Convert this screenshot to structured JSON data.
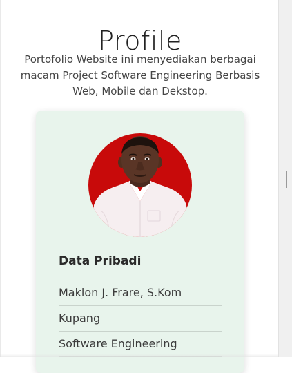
{
  "header": {
    "title": "Profile",
    "subtitle": "Portofolio Website ini menyediakan berbagai macam Project Software Engineering Berbasis Web, Mobile dan Dekstop."
  },
  "profile": {
    "section_title": "Data Pribadi",
    "photo_background_color": "#c80a0a",
    "card_color": "#e8f4ec",
    "items": [
      "Maklon J. Frare, S.Kom",
      "Kupang",
      "Software Engineering"
    ]
  }
}
